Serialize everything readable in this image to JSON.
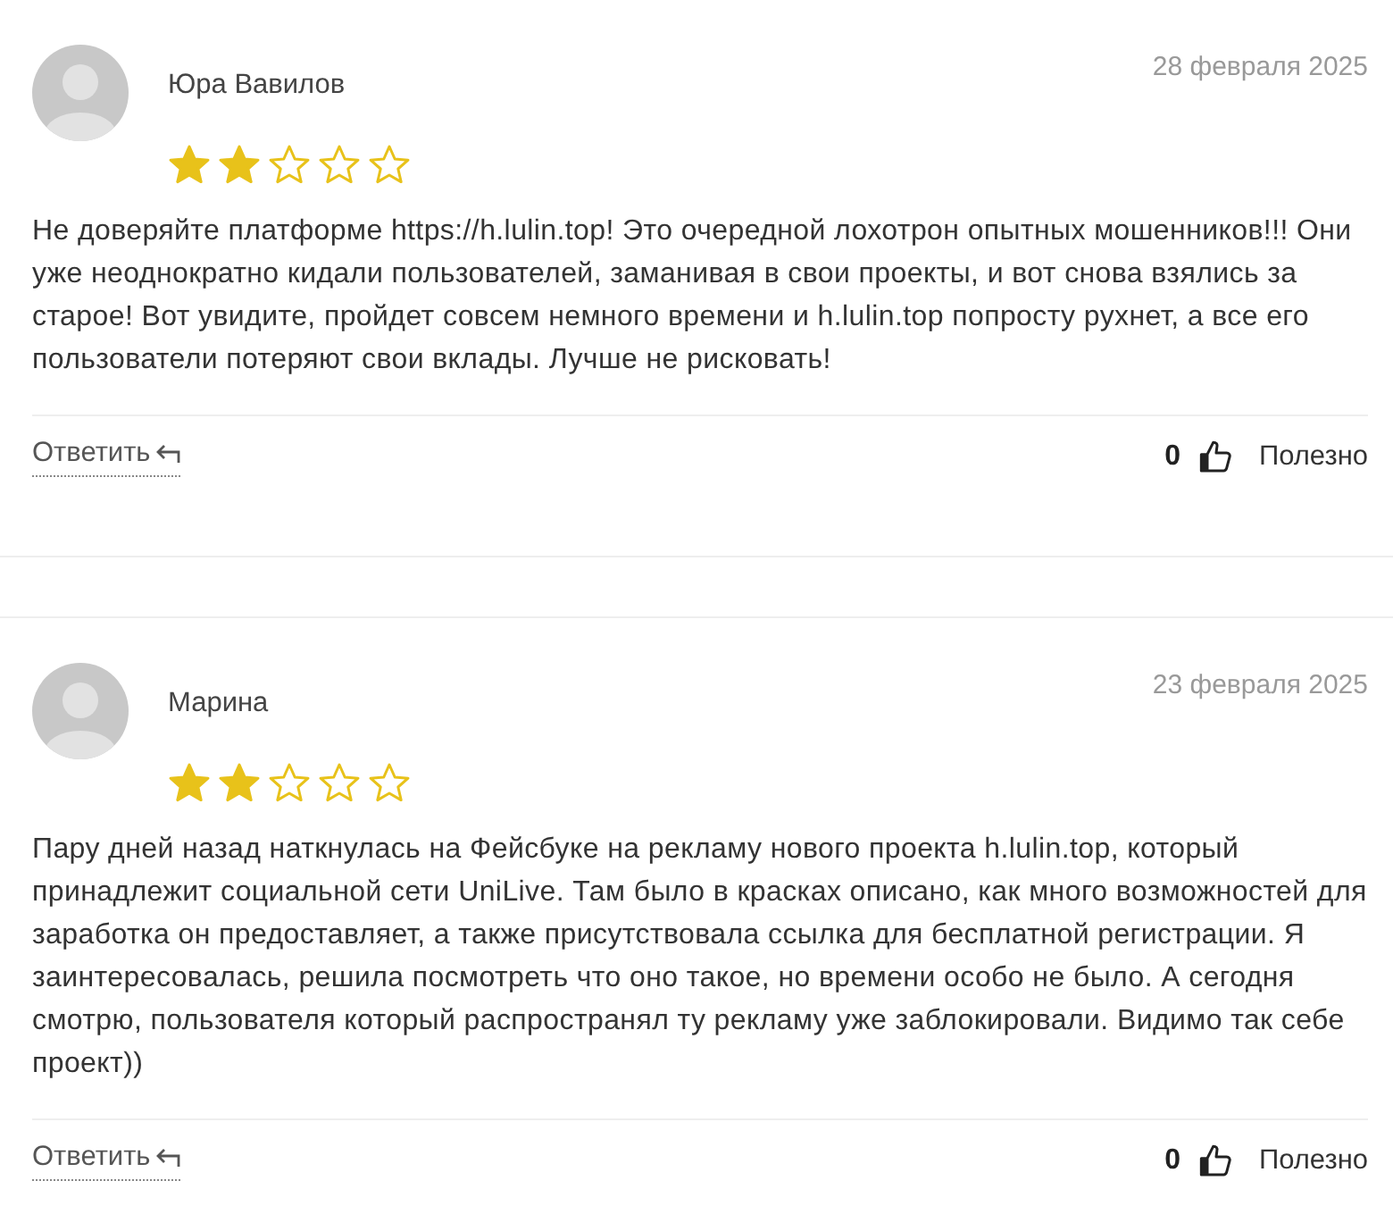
{
  "reviews": [
    {
      "author": "Юра Вавилов",
      "date": "28 февраля 2025",
      "stars": 2,
      "text": "Не доверяйте платформе https://h.lulin.top! Это очередной лохотрон опытных мошенников!!! Они уже неоднократно кидали пользователей, заманивая в свои проекты, и вот снова взялись за старое! Вот увидите, пройдет совсем немного времени и h.lulin.top попросту рухнет, а все его пользователи потеряют свои вклады. Лучше не рисковать!",
      "reply": "Ответить",
      "likes": "0",
      "helpful": "Полезно"
    },
    {
      "author": "Марина",
      "date": "23 февраля 2025",
      "stars": 2,
      "text": "Пару дней назад наткнулась на Фейсбуке на рекламу нового проекта h.lulin.top, который принадлежит социальной сети UniLive. Там было в красках описано, как много возможностей для заработка он предоставляет, а также присутствовала ссылка для бесплатной регистрации. Я заинтересовалась, решила посмотреть что оно такое, но времени особо не было. А сегодня смотрю, пользователя который распространял ту рекламу уже заблокировали. Видимо так себе проект))",
      "reply": "Ответить",
      "likes": "0",
      "helpful": "Полезно"
    }
  ]
}
